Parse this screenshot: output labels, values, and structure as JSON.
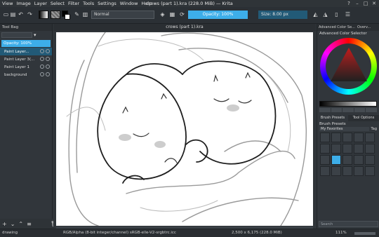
{
  "window": {
    "title": "crows (part 1).kra (228.0 MiB) — Krita"
  },
  "menubar": [
    "View",
    "Image",
    "Layer",
    "Select",
    "Filter",
    "Tools",
    "Settings",
    "Window",
    "Help"
  ],
  "toolbar": {
    "blend_mode": "Normal",
    "opacity_label": "Opacity: 100%",
    "opacity_value": 1.0,
    "size_label": "Size: 8.00 px",
    "foreground_color": "#000000",
    "background_color": "#ffffff"
  },
  "left_panel": {
    "header": "Tool Bag",
    "opacity_label": "Opacity: 100%",
    "layers": [
      {
        "name": "Paint Layer...",
        "selected": true
      },
      {
        "name": "Paint Layer 3(...",
        "selected": false
      },
      {
        "name": "Paint Layer 1",
        "selected": false
      },
      {
        "name": "background",
        "selected": false
      }
    ]
  },
  "document": {
    "tab_title": "crows (part 1).kra"
  },
  "right_panel": {
    "tabs": [
      "Advanced Color Se...",
      "Overv..."
    ],
    "selector_title": "Advanced Color Selector",
    "subtabs": [
      "Brush Presets",
      "Tool Options"
    ],
    "presets_title": "Brush Presets",
    "preset_filter": "My Favorites",
    "tag_label": "Tag",
    "search_placeholder": "Search"
  },
  "status": {
    "tool": "drawing",
    "color_info": "RGB/Alpha (8-bit integer/channel)  sRGB-elle-V2-srgbtrc.icc",
    "doc_info": "2,500 x 6,175 (228.0 MiB)",
    "zoom": "111%"
  },
  "colors": {
    "accent": "#3daee9",
    "selection": "#225a77",
    "panel": "#31363b"
  }
}
